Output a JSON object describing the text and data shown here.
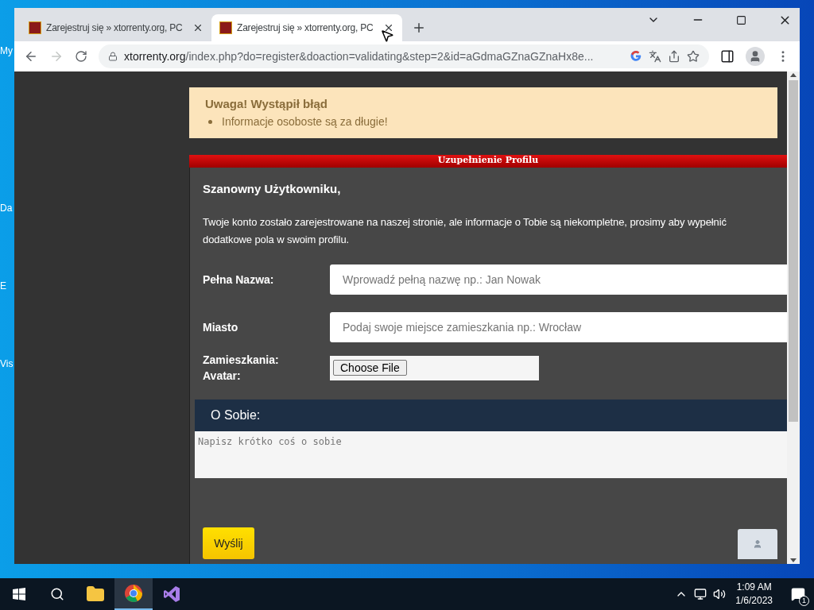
{
  "desktop_icons": [
    {
      "label": "My"
    },
    {
      "label": "Da"
    },
    {
      "label": "E"
    },
    {
      "label": "Vis"
    }
  ],
  "browser": {
    "tabs": [
      {
        "title": "Zarejestruj się » xtorrenty.org, PC",
        "selected": false
      },
      {
        "title": "Zarejestruj się » xtorrenty.org, PC",
        "selected": true
      }
    ],
    "address": {
      "host": "xtorrenty.org",
      "path": "/index.php?do=register&doaction=validating&step=2&id=aGdmaGZnaGZnaHx8e..."
    }
  },
  "notice": {
    "title": "Uwaga! Wystąpił błąd",
    "items": [
      "Informacje osoboste są za długie!"
    ]
  },
  "panel": {
    "header": "Uzupełnienie Profilu",
    "greeting": "Szanowny Użytkowniku,",
    "message": "Twoje konto zostało zarejestrowane na naszej stronie, ale informacje o Tobie są niekompletne, prosimy aby wypełnić dodatkowe pola w swoim profilu.",
    "fields": [
      {
        "label": "Pełna Nazwa:",
        "placeholder": "Wprowadź pełną nazwę np.: Jan Nowak"
      },
      {
        "label": "Miasto",
        "placeholder": "Podaj swoje miejsce zamieszkania np.: Wrocław"
      }
    ],
    "avatar": {
      "labels": [
        "Zamieszkania:",
        "Avatar:"
      ],
      "button": "Choose File"
    },
    "about": {
      "title": "O Sobie:",
      "placeholder": "Napisz krótko coś o sobie"
    },
    "submit": "Wyślij"
  },
  "taskbar": {
    "apps": [
      {
        "kind": "folder",
        "active": false
      },
      {
        "kind": "chrome",
        "active": true
      },
      {
        "kind": "studio",
        "active": false
      }
    ],
    "time": "1:09 AM",
    "date": "1/6/2023",
    "notifications": "1"
  }
}
